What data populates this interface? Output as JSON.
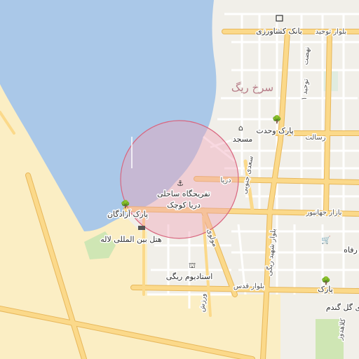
{
  "map": {
    "colors": {
      "water": "#aac8e8",
      "sand": "#fbeec4",
      "land": "#f1efe9",
      "major_road": "#fbd98a",
      "road_casing": "#e7b75b",
      "minor_road": "#ffffff",
      "park": "#cfe6b4",
      "circle_fill": "#f0a0b4",
      "circle_stroke": "#d9667f"
    },
    "district": "سرخ ریگ",
    "streets": {
      "bolvar_tohid": "بلوار توحید",
      "derya": "دریا",
      "saadi_jonubi": "سعدی جنوبی",
      "resalat": "رسالت",
      "bazar_jahanpour": "بازار جهانپور",
      "tohid_yek": "توحید ۱",
      "nahzat": "نهضت",
      "bolvar_shahid_rigi": "بلوار شهید ریگی",
      "mowlavi": "مولوی",
      "bolvar_ghods": "بلوار قدس",
      "varzesh": "ورزش",
      "kolahdooz": "کلاهدوز"
    },
    "pois": {
      "bank_keshavarzi": "بانک کشاورزی",
      "park_vahdat": "پارک وحدت",
      "masjed": "مسجد",
      "tafrihgah_line1": "تفریحگاه ساحلی",
      "tafrihgah_line2": "دریا کوچک",
      "park_azadegan": "پارک آزادگان",
      "hotel_laleh": "هتل بین المللی لاله",
      "stadium_rigi": "استادیوم ریگی",
      "park_right": "پارک",
      "gol_gandom": "ی گل گندم",
      "rafah": "رفاه"
    },
    "icons": {
      "bank": "bank-icon",
      "park": "tree-icon",
      "mosque": "mosque-icon",
      "anchor": "anchor-icon",
      "hotel": "hotel-icon",
      "stadium": "stadium-icon",
      "shop": "cart-icon"
    }
  }
}
